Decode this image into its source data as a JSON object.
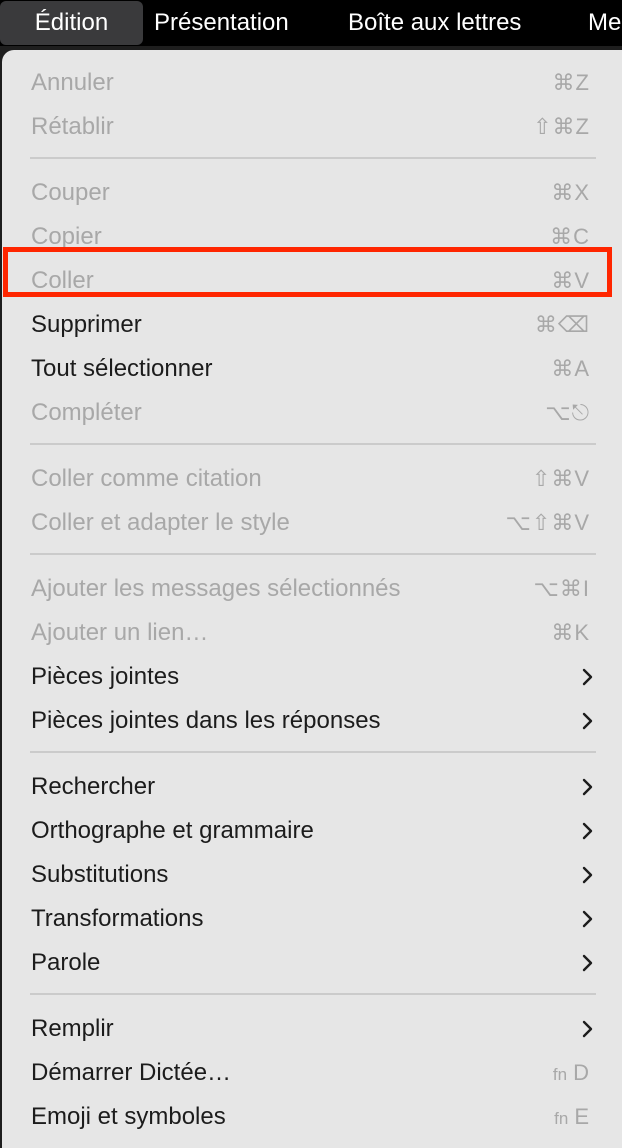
{
  "menubar": {
    "items": [
      {
        "label": "Édition",
        "active": true
      },
      {
        "label": "Présentation"
      },
      {
        "label": "Boîte aux lettres"
      },
      {
        "label": "Me"
      }
    ]
  },
  "menu": {
    "items": [
      {
        "label": "Annuler",
        "shortcut": "⌘Z",
        "disabled": true
      },
      {
        "label": "Rétablir",
        "shortcut": "⇧⌘Z",
        "disabled": true
      },
      {
        "label": "Couper",
        "shortcut": "⌘X",
        "disabled": true
      },
      {
        "label": "Copier",
        "shortcut": "⌘C",
        "disabled": true
      },
      {
        "label": "Coller",
        "shortcut": "⌘V",
        "disabled": true
      },
      {
        "label": "Supprimer",
        "shortcut": "⌘⌫",
        "disabled": false,
        "highlighted": true
      },
      {
        "label": "Tout sélectionner",
        "shortcut": "⌘A",
        "disabled": false
      },
      {
        "label": "Compléter",
        "shortcut": "⌥⎋",
        "disabled": true
      },
      {
        "label": "Coller comme citation",
        "shortcut": "⇧⌘V",
        "disabled": true
      },
      {
        "label": "Coller et adapter le style",
        "shortcut": "⌥⇧⌘V",
        "disabled": true
      },
      {
        "label": "Ajouter les messages sélectionnés",
        "shortcut": "⌥⌘I",
        "disabled": true
      },
      {
        "label": "Ajouter un lien…",
        "shortcut": "⌘K",
        "disabled": true
      },
      {
        "label": "Pièces jointes",
        "submenu": true
      },
      {
        "label": "Pièces jointes dans les réponses",
        "submenu": true
      },
      {
        "label": "Rechercher",
        "submenu": true
      },
      {
        "label": "Orthographe et grammaire",
        "submenu": true
      },
      {
        "label": "Substitutions",
        "submenu": true
      },
      {
        "label": "Transformations",
        "submenu": true
      },
      {
        "label": "Parole",
        "submenu": true
      },
      {
        "label": "Remplir",
        "submenu": true
      },
      {
        "label": "Démarrer Dictée…",
        "shortcut_fn": "fn",
        "shortcut": "D"
      },
      {
        "label": "Emoji et symboles",
        "shortcut_fn": "fn",
        "shortcut": "E"
      }
    ]
  },
  "colors": {
    "highlight_border": "#ff2600",
    "menu_background": "#e6e6e6",
    "disabled_text": "#a8a8a8"
  }
}
